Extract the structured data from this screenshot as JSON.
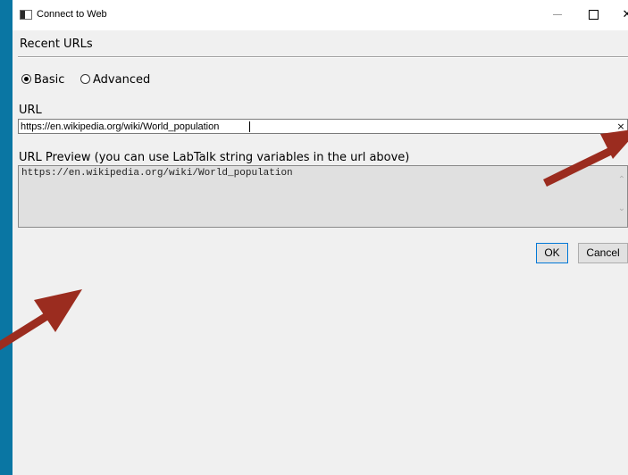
{
  "window": {
    "title": "Connect to Web"
  },
  "recent": {
    "label": "Recent URLs"
  },
  "mode": {
    "options": [
      {
        "label": "Basic",
        "checked": true
      },
      {
        "label": "Advanced",
        "checked": false
      }
    ]
  },
  "url": {
    "label": "URL",
    "value": "https://en.wikipedia.org/wiki/World_population",
    "clear_glyph": "×"
  },
  "preview": {
    "label": "URL Preview (you can use LabTalk string variables in the url above)",
    "text": "https://en.wikipedia.org/wiki/World_population"
  },
  "buttons": {
    "ok": "OK",
    "cancel": "Cancel"
  },
  "colors": {
    "desktop": "#0a76a3",
    "dialog": "#f0f0f0",
    "arrow": "#9b2c1f"
  }
}
